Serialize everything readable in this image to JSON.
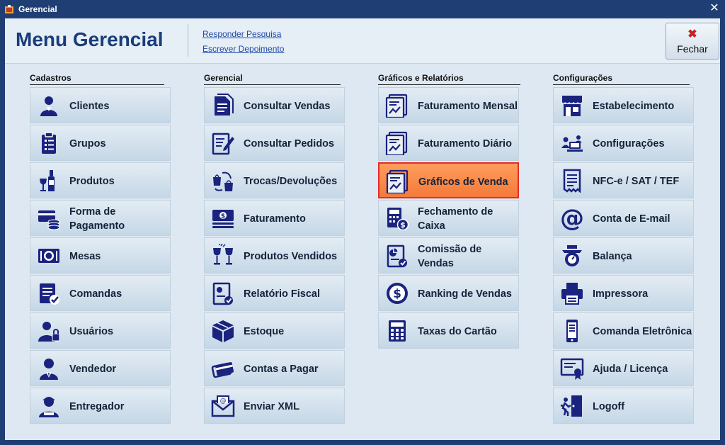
{
  "window": {
    "title": "Gerencial"
  },
  "header": {
    "title": "Menu Gerencial",
    "links": [
      "Responder Pesquisa",
      "Escrever Depoimento"
    ],
    "close_button": {
      "icon": "x-icon",
      "label": "Fechar"
    }
  },
  "colors": {
    "title_bar": "#1f3f74",
    "window_bg": "#dde8f2",
    "button": "#d4e2ee",
    "selected_button": "#f68a4a",
    "selected_border": "#e32c2c",
    "icon": "#1a237e",
    "heading": "#1a3d79"
  },
  "columns": [
    {
      "header": "Cadastros",
      "items": [
        {
          "label": "Clientes",
          "icon": "client-icon"
        },
        {
          "label": "Grupos",
          "icon": "clipboard-list-icon"
        },
        {
          "label": "Produtos",
          "icon": "wine-bottle-icon"
        },
        {
          "label": "Forma de Pagamento",
          "icon": "payment-card-icon"
        },
        {
          "label": "Mesas",
          "icon": "table-plate-icon"
        },
        {
          "label": "Comandas",
          "icon": "checklist-icon"
        },
        {
          "label": "Usuários",
          "icon": "user-lock-icon"
        },
        {
          "label": "Vendedor",
          "icon": "salesman-icon"
        },
        {
          "label": "Entregador",
          "icon": "delivery-person-icon"
        }
      ]
    },
    {
      "header": "Gerencial",
      "items": [
        {
          "label": "Consultar Vendas",
          "icon": "document-icon"
        },
        {
          "label": "Consultar Pedidos",
          "icon": "edit-document-icon"
        },
        {
          "label": "Trocas/Devoluções",
          "icon": "exchange-bags-icon"
        },
        {
          "label": "Faturamento",
          "icon": "money-stack-icon"
        },
        {
          "label": "Produtos Vendidos",
          "icon": "wine-glasses-icon"
        },
        {
          "label": "Relatório Fiscal",
          "icon": "report-check-icon"
        },
        {
          "label": "Estoque",
          "icon": "box-icon"
        },
        {
          "label": "Contas a Pagar",
          "icon": "cards-icon"
        },
        {
          "label": "Enviar XML",
          "icon": "email-envelope-icon"
        }
      ]
    },
    {
      "header": "Gráficos e Relatórios",
      "items": [
        {
          "label": "Faturamento Mensal",
          "icon": "chart-doc-icon"
        },
        {
          "label": "Faturamento Diário",
          "icon": "chart-doc-icon"
        },
        {
          "label": "Gráficos de Venda",
          "icon": "chart-doc-icon",
          "selected": true
        },
        {
          "label": "Fechamento de Caixa",
          "icon": "calculator-dollar-icon"
        },
        {
          "label": "Comissão de Vendas",
          "icon": "commission-doc-icon"
        },
        {
          "label": "Ranking de Vendas",
          "icon": "dollar-circle-icon"
        },
        {
          "label": "Taxas do Cartão",
          "icon": "calculator-icon"
        }
      ]
    },
    {
      "header": "Configurações",
      "items": [
        {
          "label": "Estabelecimento",
          "icon": "store-icon"
        },
        {
          "label": "Configurações",
          "icon": "settings-people-icon"
        },
        {
          "label": "NFC-e / SAT / TEF",
          "icon": "receipt-icon"
        },
        {
          "label": "Conta de E-mail",
          "icon": "at-sign-icon"
        },
        {
          "label": "Balança",
          "icon": "scale-icon"
        },
        {
          "label": "Impressora",
          "icon": "printer-icon"
        },
        {
          "label": "Comanda Eletrônica",
          "icon": "mobile-device-icon"
        },
        {
          "label": "Ajuda / Licença",
          "icon": "certificate-icon"
        },
        {
          "label": "Logoff",
          "icon": "exit-door-icon"
        }
      ]
    }
  ]
}
